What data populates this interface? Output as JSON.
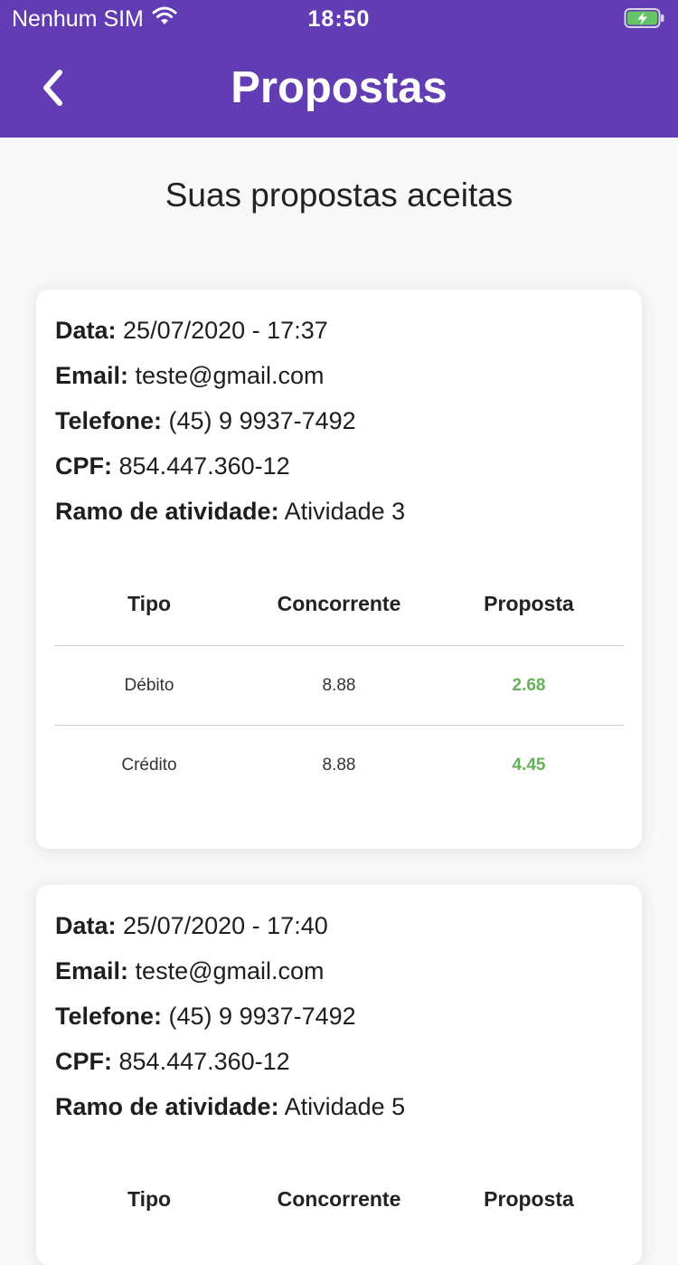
{
  "status_bar": {
    "carrier": "Nenhum SIM",
    "time": "18:50",
    "wifi_icon": "wifi-icon",
    "battery_icon": "battery-charging-icon"
  },
  "nav": {
    "title": "Propostas",
    "back_icon": "chevron-left-icon"
  },
  "section_title": "Suas propostas aceitas",
  "colors": {
    "primary": "#613cb2",
    "proposal_value": "#67b05a",
    "background": "#f8f8f8"
  },
  "proposals": [
    {
      "data_label": "Data:",
      "data": "25/07/2020 - 17:37",
      "email_label": "Email:",
      "email": "teste@gmail.com",
      "telefone_label": "Telefone:",
      "telefone": "(45) 9 9937-7492",
      "cpf_label": "CPF:",
      "cpf": "854.447.360-12",
      "ramo_label": "Ramo de atividade:",
      "ramo": "Atividade 3",
      "table": {
        "headers": [
          "Tipo",
          "Concorrente",
          "Proposta"
        ],
        "rows": [
          {
            "tipo": "Débito",
            "concorrente": "8.88",
            "proposta": "2.68"
          },
          {
            "tipo": "Crédito",
            "concorrente": "8.88",
            "proposta": "4.45"
          }
        ]
      }
    },
    {
      "data_label": "Data:",
      "data": "25/07/2020 - 17:40",
      "email_label": "Email:",
      "email": "teste@gmail.com",
      "telefone_label": "Telefone:",
      "telefone": "(45) 9 9937-7492",
      "cpf_label": "CPF:",
      "cpf": "854.447.360-12",
      "ramo_label": "Ramo de atividade:",
      "ramo": "Atividade 5",
      "table": {
        "headers": [
          "Tipo",
          "Concorrente",
          "Proposta"
        ],
        "rows": []
      }
    }
  ]
}
